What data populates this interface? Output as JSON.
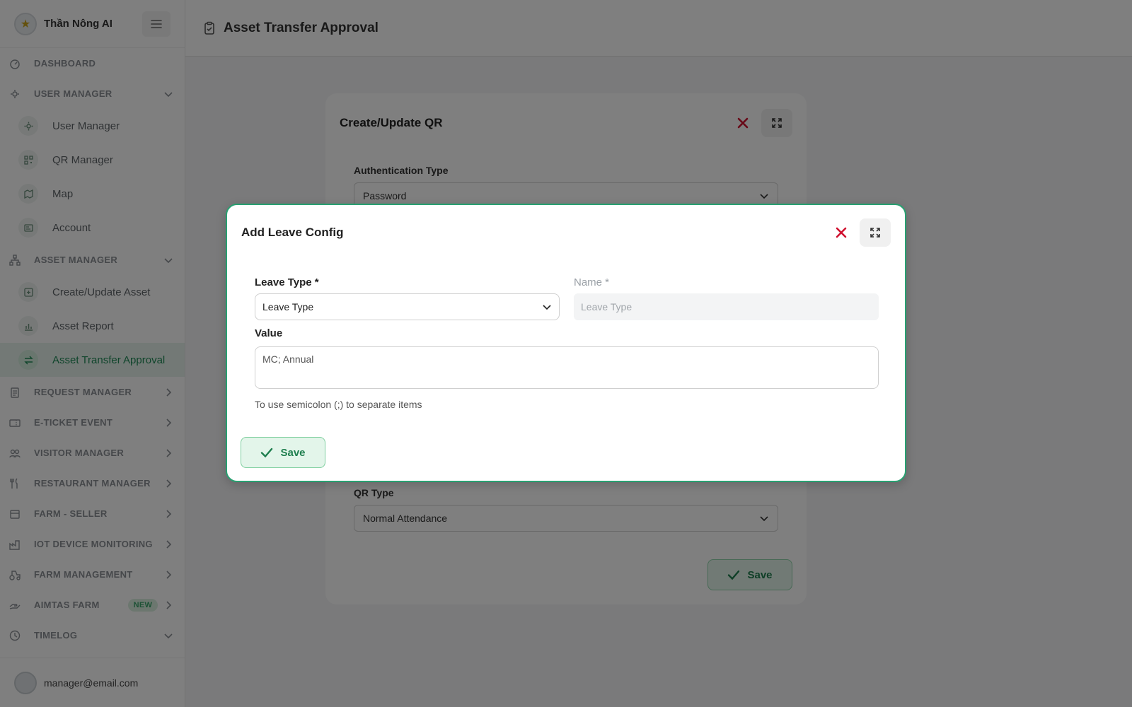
{
  "app": {
    "brand": "Thần Nông AI",
    "user_email": "manager@email.com"
  },
  "header": {
    "title": "Asset Transfer Approval"
  },
  "sidebar": {
    "items": [
      {
        "type": "section",
        "label": "DASHBOARD",
        "icon": "gauge-icon"
      },
      {
        "type": "section",
        "label": "USER MANAGER",
        "icon": "users-gear-icon",
        "expanded": true
      },
      {
        "type": "sub",
        "label": "User Manager",
        "icon": "gear-icon"
      },
      {
        "type": "sub",
        "label": "QR Manager",
        "icon": "qr-icon"
      },
      {
        "type": "sub",
        "label": "Map",
        "icon": "map-icon"
      },
      {
        "type": "sub",
        "label": "Account",
        "icon": "id-card-icon"
      },
      {
        "type": "section",
        "label": "ASSET MANAGER",
        "icon": "sitemap-icon",
        "expanded": true
      },
      {
        "type": "sub",
        "label": "Create/Update Asset",
        "icon": "plus-square-icon"
      },
      {
        "type": "sub",
        "label": "Asset Report",
        "icon": "bar-chart-icon"
      },
      {
        "type": "sub",
        "label": "Asset Transfer Approval",
        "icon": "transfer-icon",
        "active": true
      },
      {
        "type": "section",
        "label": "REQUEST MANAGER",
        "icon": "clipboard-icon"
      },
      {
        "type": "section",
        "label": "E-TICKET EVENT",
        "icon": "ticket-icon"
      },
      {
        "type": "section",
        "label": "VISITOR MANAGER",
        "icon": "visitors-icon"
      },
      {
        "type": "section",
        "label": "RESTAURANT MANAGER",
        "icon": "utensils-icon"
      },
      {
        "type": "section",
        "label": "FARM - SELLER",
        "icon": "store-icon"
      },
      {
        "type": "section",
        "label": "IOT DEVICE MONITORING",
        "icon": "factory-icon"
      },
      {
        "type": "section",
        "label": "FARM MANAGEMENT",
        "icon": "tractor-icon"
      },
      {
        "type": "section",
        "label": "AIMTAS FARM",
        "icon": "hand-icon",
        "badge": "NEW"
      },
      {
        "type": "section",
        "label": "TIMELOG",
        "icon": "clock-icon",
        "expanded": true
      }
    ]
  },
  "back_modal": {
    "title": "Create/Update QR",
    "auth_label": "Authentication Type",
    "auth_value": "Password",
    "qr_type_label": "QR Type",
    "qr_type_value": "Normal Attendance",
    "save_label": "Save"
  },
  "front_modal": {
    "title": "Add Leave Config",
    "leave_type_label": "Leave Type *",
    "leave_type_value": "Leave Type",
    "name_label": "Name *",
    "name_placeholder": "Leave Type",
    "value_label": "Value",
    "value_text": "MC; Annual",
    "help_text": "To use semicolon (;) to separate items",
    "save_label": "Save"
  },
  "colors": {
    "accent": "#28a071",
    "close": "#d0102f",
    "overlay": "rgba(0,0,0,0.5)"
  }
}
